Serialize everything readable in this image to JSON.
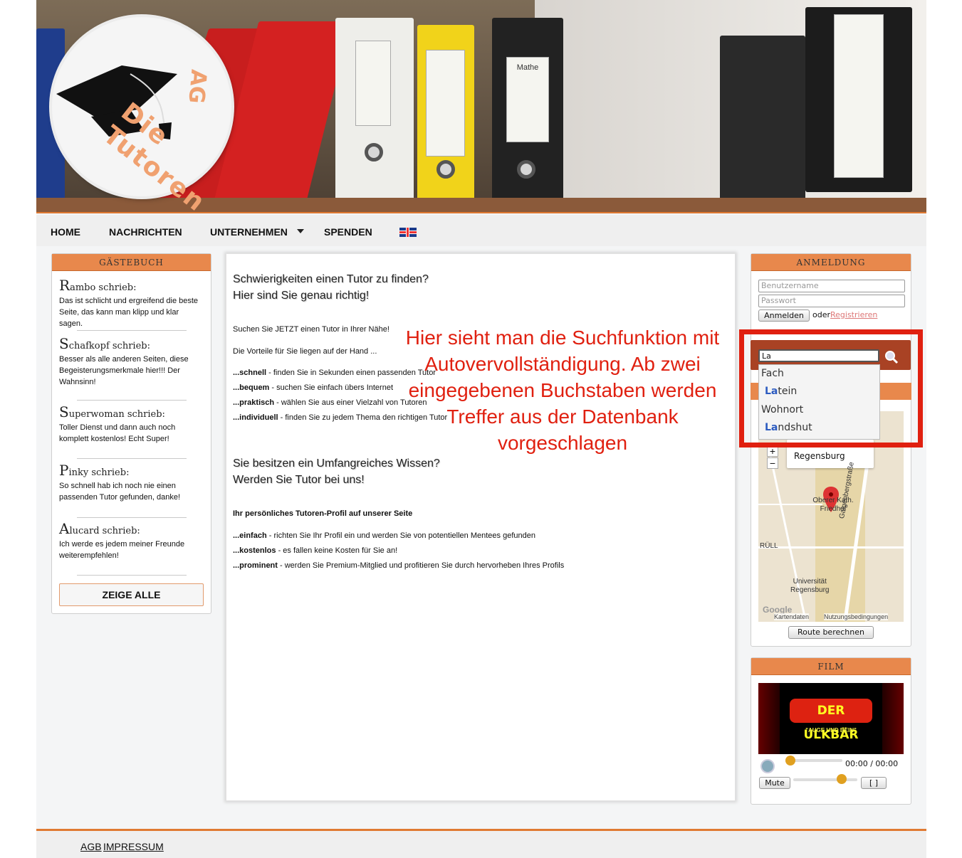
{
  "logo": {
    "text": "Die Tutoren",
    "suffix": "AG"
  },
  "header": {
    "binder_label": "Mathe"
  },
  "nav": {
    "items": [
      "HOME",
      "NACHRICHTEN",
      "UNTERNEHMEN",
      "SPENDEN"
    ],
    "language_flag": "english-flag-icon"
  },
  "guestbook": {
    "title": "GÄSTEBUCH",
    "entries": [
      {
        "initial": "R",
        "name": "ambo schrieb:",
        "text": "Das ist schlicht und ergreifend die beste Seite, das kann man klipp und klar sagen."
      },
      {
        "initial": "S",
        "name": "chafkopf schrieb:",
        "text": "Besser als alle anderen Seiten, diese Begeisterungsmerkmale hier!!! Der Wahnsinn!"
      },
      {
        "initial": "S",
        "name": "uperwoman schrieb:",
        "text": "Toller Dienst und dann auch noch komplett kostenlos! Echt Super!"
      },
      {
        "initial": "P",
        "name": "inky schrieb:",
        "text": "So schnell hab ich noch nie einen passenden Tutor gefunden, danke!"
      },
      {
        "initial": "A",
        "name": "lucard schrieb:",
        "text": "Ich werde es jedem meiner Freunde weiterempfehlen!"
      }
    ],
    "show_all": "ZEIGE ALLE"
  },
  "main": {
    "heading1_line1": "Schwierigkeiten einen Tutor zu finden?",
    "heading1_line2": "Hier sind Sie genau richtig!",
    "intro1": "Suchen Sie JETZT einen Tutor in Ihrer Nähe!",
    "intro2": "Die Vorteile für Sie liegen auf der Hand ...",
    "benefits": [
      {
        "key": "...schnell",
        "text": " - finden Sie in Sekunden einen passenden Tutor"
      },
      {
        "key": "...bequem",
        "text": " - suchen Sie einfach übers Internet"
      },
      {
        "key": "...praktisch",
        "text": " - wählen Sie aus einer Vielzahl von Tutoren"
      },
      {
        "key": "...individuell",
        "text": " - finden Sie zu jedem Thema den richtigen Tutor"
      }
    ],
    "heading2_line1": "Sie besitzen ein Umfangreiches Wissen?",
    "heading2_line2": "Werden Sie Tutor bei uns!",
    "profile_title": "Ihr persönliches Tutoren-Profil auf unserer Seite",
    "profile_benefits": [
      {
        "key": "...einfach",
        "text": " - richten Sie Ihr Profil ein und werden Sie von potentiellen Mentees gefunden"
      },
      {
        "key": "...kostenlos",
        "text": " - es fallen keine Kosten für Sie an!"
      },
      {
        "key": "...prominent",
        "text": " - werden Sie Premium-Mitglied und profitieren Sie durch hervorheben Ihres Profils"
      }
    ]
  },
  "login": {
    "title": "ANMELDUNG",
    "username_placeholder": "Benutzername",
    "password_placeholder": "Passwort",
    "login_button": "Anmelden",
    "or_text": "oder",
    "register_link": "Registrieren"
  },
  "search": {
    "value": "La",
    "autocomplete": [
      {
        "category": "Fach",
        "match": "La",
        "rest": "tein"
      },
      {
        "category": "Wohnort",
        "match": "La",
        "rest": "ndshut"
      }
    ]
  },
  "map": {
    "popup_city": "Regensburg",
    "zoom_in": "+",
    "zoom_out": "−",
    "label_friedhof": "Oberer Kath. Friedhof",
    "label_uni_1": "Universität",
    "label_uni_2": "Regensburg",
    "label_street": "Galgenbergstraße",
    "label_rull": "RÜLL",
    "google": "Google",
    "map_data": "Kartendaten",
    "terms": "Nutzungsbedingungen",
    "route_button": "Route berechnen"
  },
  "annotation": {
    "text": "Hier sieht man die Suchfunktion mit Autovervollständigung. Ab zwei eingegebenen Buchstaben werden Treffer aus der Datenbank vorgeschlagen"
  },
  "film": {
    "title": "FILM",
    "video_title": "DER ULKBÄR",
    "video_subtitle": "\"AUGE UND BEIN\"",
    "time": "00:00 / 00:00",
    "mute": "Mute",
    "fullscreen": "[ ]",
    "progress": 0,
    "volume": 0.8
  },
  "footer": {
    "agb": "AGB",
    "impressum": "IMPRESSUM"
  },
  "colors": {
    "accent": "#e8884c",
    "annotation": "#e02010",
    "search_bar": "#a94224"
  }
}
